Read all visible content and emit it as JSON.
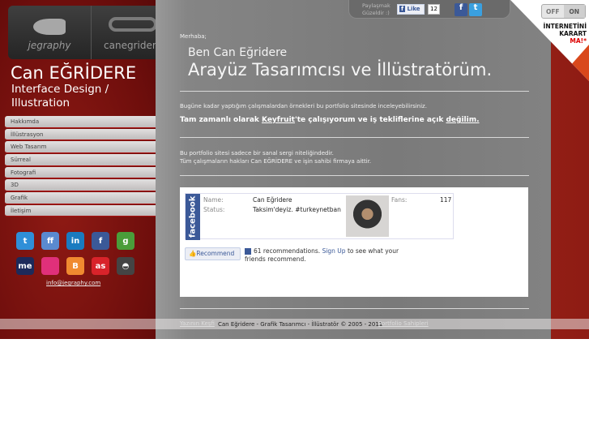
{
  "logos": [
    "jegraphy",
    "canegridere"
  ],
  "profile": {
    "name": "Can EĞRİDERE",
    "subtitle": "Interface Design / Illustration"
  },
  "nav": [
    "Hakkımda",
    "İllüstrasyon",
    "Web Tasarım",
    "Sürreal",
    "Fotografi",
    "3D",
    "Grafik",
    "İletişim"
  ],
  "social": [
    {
      "name": "twitter",
      "label": "t",
      "color": "#2f8fd8"
    },
    {
      "name": "friendfeed",
      "label": "ff",
      "color": "#5a8ad0"
    },
    {
      "name": "linkedin",
      "label": "in",
      "color": "#1a7bc0"
    },
    {
      "name": "facebook",
      "label": "f",
      "color": "#3b5998"
    },
    {
      "name": "google",
      "label": "g",
      "color": "#4a9d3a"
    },
    {
      "name": "me",
      "label": "me",
      "color": "#1d2a5a"
    },
    {
      "name": "flickr-grid",
      "label": "",
      "color": "#e0307a"
    },
    {
      "name": "blogger",
      "label": "B",
      "color": "#f08a30"
    },
    {
      "name": "lastfm",
      "label": "as",
      "color": "#d8232a"
    },
    {
      "name": "grooveshark",
      "label": "◓",
      "color": "#444444"
    }
  ],
  "email": "info@jegraphy.com",
  "share": {
    "text1": "Paylaşmak",
    "text2": "Güzeldir :)",
    "like": "Like",
    "count": "12"
  },
  "toggle": {
    "off": "OFF",
    "on": "ON"
  },
  "karart": {
    "line1": "İNTERNETİNİ",
    "line2": "KARART",
    "line3": "MA!*"
  },
  "main": {
    "hello": "Merhaba;",
    "line1": "Ben Can Eğridere",
    "line2": "Arayüz Tasarımcısı ve İllüstratörüm.",
    "p1": "Bugüne kadar yaptığım çalışmalardan örnekleri bu portfolio sitesinde inceleyebilirsiniz.",
    "p2_a": "Tam zamanlı olarak ",
    "p2_link": "Keyfruit",
    "p2_b": "'te çalışıyorum ve iş tekliflerine açık ",
    "p2_link2": "değilim.",
    "p3_1": "Bu portfolio sitesi sadece bir sanal sergi niteliğindedir.",
    "p3_2": "Tüm çalışmaların hakları Can EĞRİDERE ve işin sahibi firmaya aittir."
  },
  "facebook": {
    "brand": "facebook",
    "name_label": "Name:",
    "name": "Can Eğridere",
    "status_label": "Status:",
    "status": "Taksim'deyiz. #turkeynetban",
    "fans_label": "Fans:",
    "fans": "117",
    "recommend": "Recommend",
    "rec_text1": "61 recommendations.",
    "signup": "Sign Up",
    "rec_text2": "to see what your friends recommend."
  },
  "footer": {
    "text": "Can Eğridere - Grafik Tasarımcı - İllüstratör ©  2005 - 2011",
    "link_left": "Yazının Keşfi",
    "link_right": "Portfolio Sahipleri"
  }
}
